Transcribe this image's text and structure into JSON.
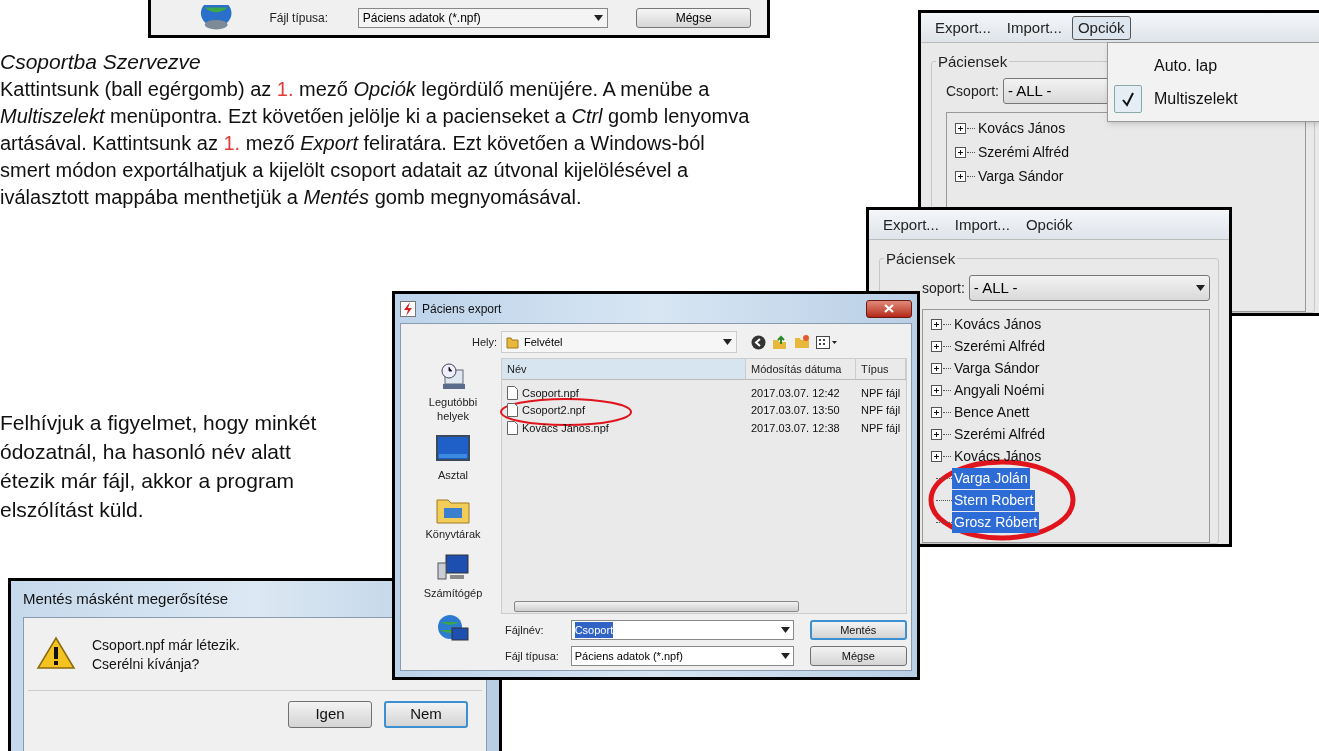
{
  "top_dialog_fragment": {
    "file_type_label": "Fájl típusa:",
    "file_type_value": "Páciens adatok (*.npf)",
    "cancel_button": "Mégse"
  },
  "section": {
    "heading": "Csoportba Szervezve",
    "lines": [
      [
        {
          "kind": "text",
          "text": "Kattintsunk (ball egérgomb) az "
        },
        {
          "kind": "number",
          "text": "1."
        },
        {
          "kind": "text",
          "text": " mező "
        },
        {
          "kind": "italic",
          "text": "Opciók"
        },
        {
          "kind": "text",
          "text": " legördülő menüjére. A menübe a"
        }
      ],
      [
        {
          "kind": "italic",
          "text": "Multiszelekt"
        },
        {
          "kind": "text",
          "text": " menüpontra. Ezt követően jelölje ki a pacienseket a "
        },
        {
          "kind": "italic",
          "text": "Ctrl"
        },
        {
          "kind": "text",
          "text": " gomb lenyomva"
        }
      ],
      [
        {
          "kind": "text",
          "text": "artásával. Kattintsunk az "
        },
        {
          "kind": "number",
          "text": "1."
        },
        {
          "kind": "text",
          "text": " mező "
        },
        {
          "kind": "italic",
          "text": "Export"
        },
        {
          "kind": "text",
          "text": " feliratára. Ezt követően a Windows-ból"
        }
      ],
      [
        {
          "kind": "text",
          "text": "smert módon exportálhatjuk a kijelölt csoport adatait az útvonal kijelölésével a"
        }
      ],
      [
        {
          "kind": "text",
          "text": "iválasztott mappába menthetjük a "
        },
        {
          "kind": "italic",
          "text": "Mentés"
        },
        {
          "kind": "text",
          "text": " gomb megnyomásával."
        }
      ]
    ]
  },
  "note": {
    "lines": [
      "Felhívjuk a figyelmet, hogy minkét",
      "ódozatnál, ha hasonló név alatt",
      "étezik már fájl, akkor a program",
      "elszólítást küld."
    ]
  },
  "options_window": {
    "menu": [
      {
        "label": "Export...",
        "selected": false
      },
      {
        "label": "Import...",
        "selected": false
      },
      {
        "label": "Opciók",
        "selected": true
      }
    ],
    "dropdown": [
      {
        "label": "Auto. lap",
        "checked": false
      },
      {
        "label": "Multiszelekt",
        "checked": true
      }
    ],
    "group_title": "Páciensek",
    "group_label": "Csoport:",
    "group_value": "- ALL -",
    "tree": [
      {
        "kind": "group",
        "label": "Kovács János",
        "selected": false
      },
      {
        "kind": "group",
        "label": "Szerémi Alfréd",
        "selected": false
      },
      {
        "kind": "group",
        "label": "Varga Sándor",
        "selected": false
      }
    ]
  },
  "selection_window": {
    "menu": [
      {
        "label": "Export...",
        "selected": false
      },
      {
        "label": "Import...",
        "selected": false
      },
      {
        "label": "Opciók",
        "selected": false
      }
    ],
    "group_title": "Páciensek",
    "group_label": "soport:",
    "group_value": "- ALL -",
    "tree": [
      {
        "kind": "group",
        "label": "Kovács János",
        "selected": false
      },
      {
        "kind": "group",
        "label": "Szerémi Alfréd",
        "selected": false
      },
      {
        "kind": "group",
        "label": "Varga Sándor",
        "selected": false
      },
      {
        "kind": "group",
        "label": "Angyali Noémi",
        "selected": false
      },
      {
        "kind": "group",
        "label": "Bence Anett",
        "selected": false
      },
      {
        "kind": "group",
        "label": "Szerémi Alfréd",
        "selected": false
      },
      {
        "kind": "group",
        "label": "Kovács János",
        "selected": false
      },
      {
        "kind": "leaf",
        "label": "Varga Jolán",
        "selected": true
      },
      {
        "kind": "leaf",
        "label": "Stern Robert",
        "selected": true
      },
      {
        "kind": "leaf",
        "label": "Grosz Róbert",
        "selected": true
      }
    ]
  },
  "export_dialog": {
    "title": "Páciens export",
    "location_label": "Hely:",
    "location_value": "Felvétel",
    "places": [
      {
        "kind": "recent",
        "label": "Legutóbbi helyek"
      },
      {
        "kind": "desktop",
        "label": "Asztal"
      },
      {
        "kind": "libraries",
        "label": "Könyvtárak"
      },
      {
        "kind": "computer",
        "label": "Számítógép"
      },
      {
        "kind": "network"
      }
    ],
    "columns": [
      "Név",
      "Módosítás dátuma",
      "Típus"
    ],
    "rows": [
      {
        "name": "Csoport.npf",
        "modified": "2017.03.07. 12:42",
        "type": "NPF fájl"
      },
      {
        "name": "Csoport2.npf",
        "modified": "2017.03.07. 13:50",
        "type": "NPF fájl"
      },
      {
        "name": "Kovács János.npf",
        "modified": "2017.03.07. 12:38",
        "type": "NPF fájl"
      }
    ],
    "filename_label": "Fájlnév:",
    "filename_value": "Csoport",
    "filetype_label": "Fájl típusa:",
    "filetype_value": "Páciens adatok (*.npf)",
    "buttons": [
      {
        "label": "Mentés",
        "default": true
      },
      {
        "label": "Mégse",
        "default": false
      }
    ]
  },
  "confirm_dialog": {
    "title": "Mentés másként megerősítése",
    "message_lines": [
      "Csoport.npf már létezik.",
      "Cserélni kívánja?"
    ],
    "buttons": [
      {
        "label": "Igen",
        "default": false
      },
      {
        "label": "Nem",
        "default": true
      }
    ]
  }
}
